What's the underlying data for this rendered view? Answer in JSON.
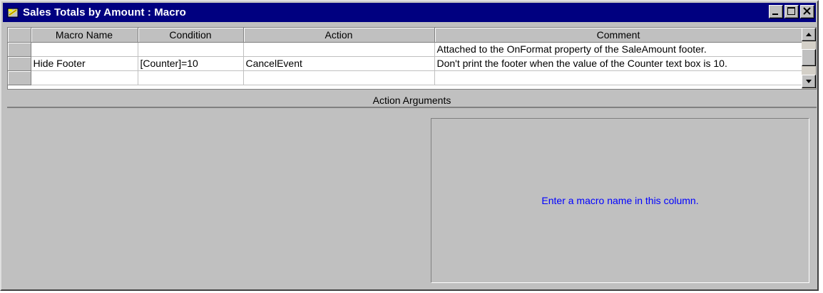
{
  "window": {
    "title": "Sales Totals by Amount : Macro",
    "controls": {
      "minimize": "minimize",
      "maximize": "maximize",
      "close": "close"
    }
  },
  "grid": {
    "columns": [
      "Macro Name",
      "Condition",
      "Action",
      "Comment"
    ],
    "rows": [
      [
        "",
        "",
        "",
        "Attached to the OnFormat property of the SaleAmount footer."
      ],
      [
        "Hide Footer",
        "[Counter]=10",
        "CancelEvent",
        "Don't print the footer when the value of the Counter text box is 10."
      ],
      [
        "",
        "",
        "",
        ""
      ]
    ]
  },
  "action_arguments": {
    "header": "Action Arguments",
    "help_text": "Enter a macro name in this column."
  },
  "colors": {
    "titlebar": "#000080",
    "help_text": "#0000ff",
    "face": "#c0c0c0"
  }
}
